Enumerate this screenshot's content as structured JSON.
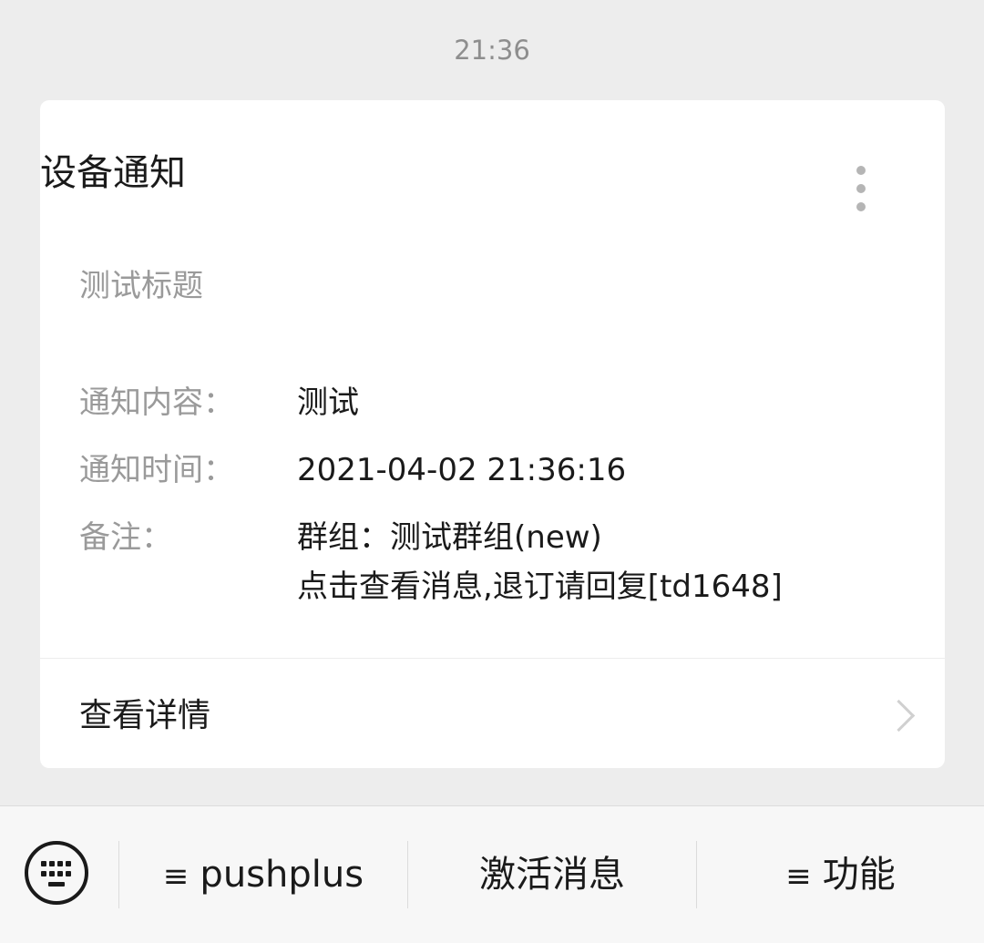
{
  "chat": {
    "timestamp": "21:36"
  },
  "card": {
    "title": "设备通知",
    "subtitle": "测试标题",
    "fields": [
      {
        "label": "通知内容：",
        "value": "测试"
      },
      {
        "label": "通知时间：",
        "value": "2021-04-02 21:36:16"
      },
      {
        "label": "备注：",
        "value": "群组：测试群组(new)",
        "value2": "点击查看消息,退订请回复[td1648]"
      }
    ],
    "detail_label": "查看详情"
  },
  "menu_bar": {
    "keyboard_icon": "keyboard-icon",
    "items": [
      {
        "icon": "≡",
        "label": "pushplus"
      },
      {
        "icon": "",
        "label": "激活消息"
      },
      {
        "icon": "≡",
        "label": "功能"
      }
    ]
  }
}
